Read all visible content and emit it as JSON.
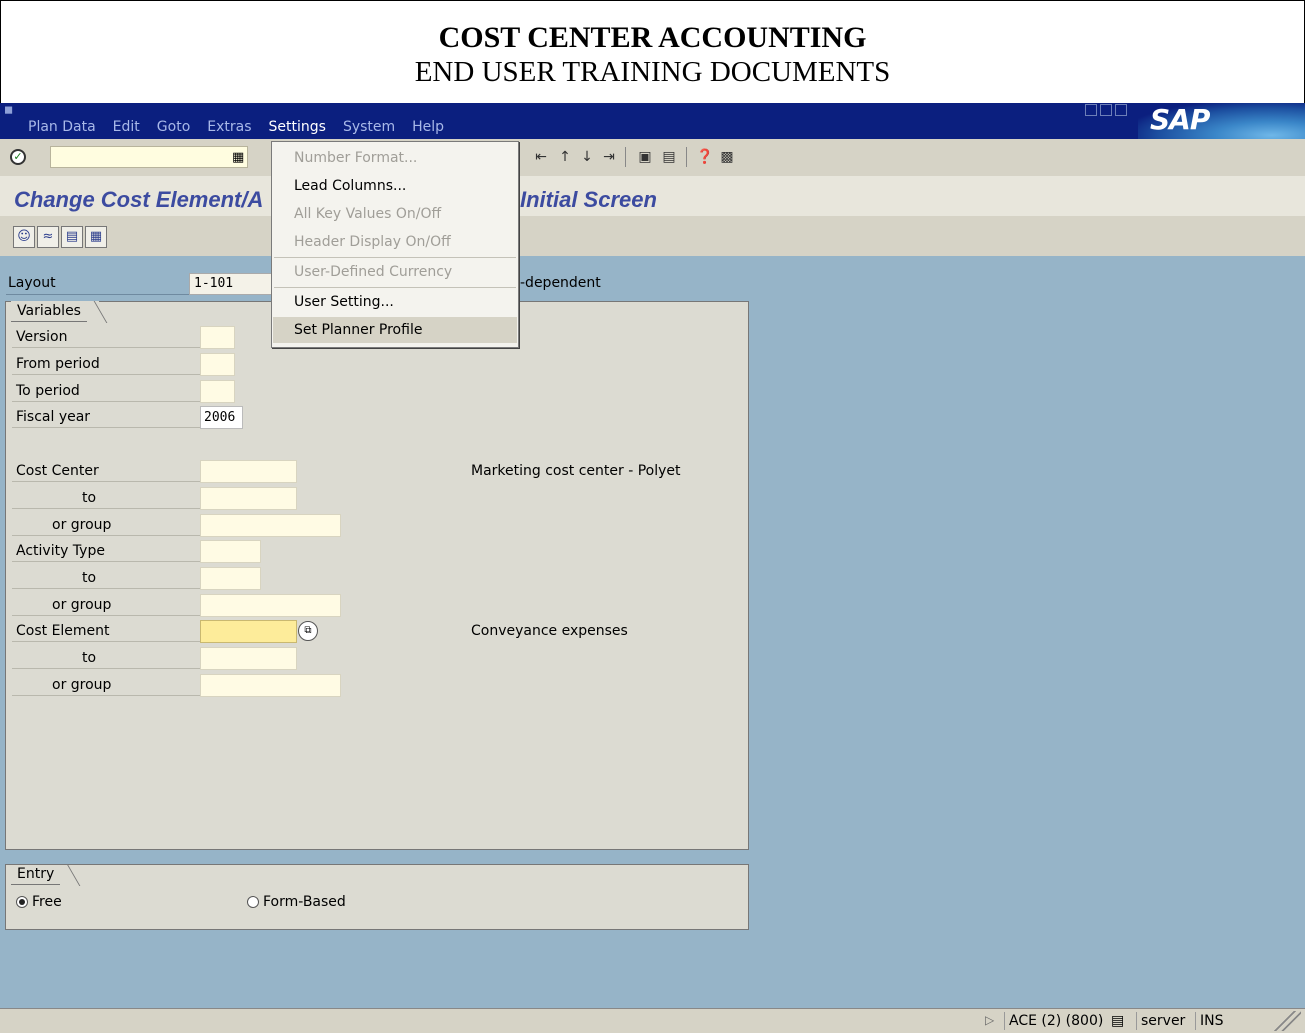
{
  "doc": {
    "title": "COST CENTER ACCOUNTING",
    "subtitle": "END USER TRAINING DOCUMENTS"
  },
  "menubar": {
    "items": [
      "Plan Data",
      "Edit",
      "Goto",
      "Extras",
      "Settings",
      "System",
      "Help"
    ],
    "active": "Settings",
    "logo": "SAP"
  },
  "page": {
    "title": "Change Cost Element/A",
    "title_tail": "Initial Screen"
  },
  "layout": {
    "label": "Layout",
    "value": "1-101",
    "suffix": "-dependent"
  },
  "variables": {
    "title": "Variables",
    "version_label": "Version",
    "from_period_label": "From period",
    "to_period_label": "To period",
    "fiscal_year_label": "Fiscal year",
    "fiscal_year_value": "2006",
    "cost_center_label": "Cost Center",
    "cost_center_to_label": "to",
    "cost_center_group_label": "or group",
    "cost_center_desc": "Marketing cost center - Polyet",
    "activity_type_label": "Activity Type",
    "activity_type_to_label": "to",
    "activity_type_group_label": "or group",
    "cost_element_label": "Cost Element",
    "cost_element_to_label": "to",
    "cost_element_group_label": "or group",
    "cost_element_desc": "Conveyance expenses"
  },
  "entry": {
    "title": "Entry",
    "option_free": "Free",
    "option_form": "Form-Based",
    "selected": "Free"
  },
  "settings_menu": {
    "number_format": "Number Format...",
    "lead_columns": "Lead Columns...",
    "all_key_values": "All Key Values On/Off",
    "header_display": "Header Display On/Off",
    "user_currency": "User-Defined Currency",
    "user_setting": "User Setting...",
    "planner_profile": "Set Planner Profile"
  },
  "statusbar": {
    "system": "ACE (2) (800)",
    "server": "server",
    "mode": "INS"
  }
}
